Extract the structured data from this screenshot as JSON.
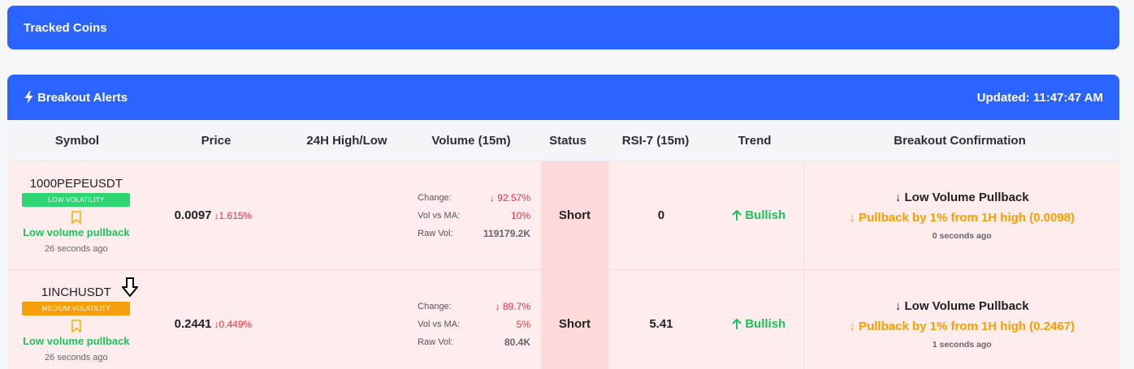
{
  "tracked": {
    "title": "Tracked Coins"
  },
  "alerts": {
    "title": "Breakout Alerts",
    "updated": "Updated: 11:47:47 AM",
    "columns": {
      "symbol": "Symbol",
      "price": "Price",
      "high_low": "24H High/Low",
      "volume": "Volume (15m)",
      "status": "Status",
      "rsi": "RSI-7 (15m)",
      "trend": "Trend",
      "confirmation": "Breakout Confirmation"
    },
    "rows": [
      {
        "symbol": "1000PEPEUSDT",
        "volatility": "LOW VOLATILITY",
        "volatility_color": "#2ed573",
        "note": "Low volume pullback",
        "ago": "26 seconds ago",
        "price": "0.0097",
        "price_change": "↓1.615%",
        "change_label": "Change:",
        "change_value": "↓ 92.57%",
        "vol_ma_label": "Vol vs MA:",
        "vol_ma_value": "10%",
        "raw_vol_label": "Raw Vol:",
        "raw_vol_value": "119179.2K",
        "status": "Short",
        "rsi": "0",
        "trend": "Bullish",
        "conf_title": "↓ Low Volume Pullback",
        "conf_detail": "↓ Pullback by 1% from 1H high (0.0098)",
        "conf_ago": "0 seconds ago"
      },
      {
        "symbol": "1INCHUSDT",
        "volatility": "MEDIUM VOLATILITY",
        "volatility_color": "#f59f0a",
        "note": "Low volume pullback",
        "ago": "26 seconds ago",
        "price": "0.2441",
        "price_change": "↓0.449%",
        "change_label": "Change:",
        "change_value": "↓ 89.7%",
        "vol_ma_label": "Vol vs MA:",
        "vol_ma_value": "5%",
        "raw_vol_label": "Raw Vol:",
        "raw_vol_value": "80.4K",
        "status": "Short",
        "rsi": "5.41",
        "trend": "Bullish",
        "conf_title": "↓ Low Volume Pullback",
        "conf_detail": "↓ Pullback by 1% from 1H high (0.2467)",
        "conf_ago": "1 seconds ago"
      }
    ]
  },
  "colors": {
    "accent": "#2b63ff",
    "row_bg": "#ffeced",
    "bullish": "#1fc15e",
    "warning": "#f5a000",
    "negative": "#e0334a"
  },
  "icons": {
    "bolt": "bolt-icon",
    "bookmark": "bookmark-icon",
    "trend": "arrow-up-icon"
  }
}
